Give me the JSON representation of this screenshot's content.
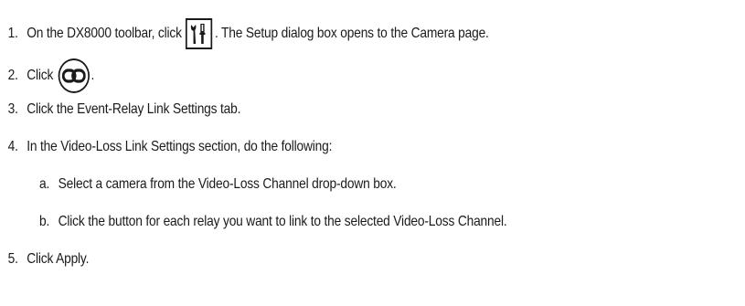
{
  "steps": [
    {
      "number": "1.",
      "text_before": "On the DX8000 toolbar, click",
      "icon": "setup-tools-icon",
      "text_after": ". The Setup dialog box opens to the Camera page."
    },
    {
      "number": "2.",
      "text_before": "Click",
      "icon": "link-icon",
      "text_after": "."
    },
    {
      "number": "3.",
      "text": "Click the Event-Relay Link Settings tab."
    },
    {
      "number": "4.",
      "text": "In the Video-Loss Link Settings section, do the following:",
      "substeps": [
        {
          "letter": "a.",
          "text": "Select a camera from the Video-Loss Channel drop-down box."
        },
        {
          "letter": "b.",
          "text": "Click the button for each relay you want to link to the selected Video-Loss Channel."
        }
      ]
    },
    {
      "number": "5.",
      "text": "Click Apply."
    }
  ],
  "colors": {
    "text": "#1a1a1a",
    "background": "#ffffff"
  }
}
